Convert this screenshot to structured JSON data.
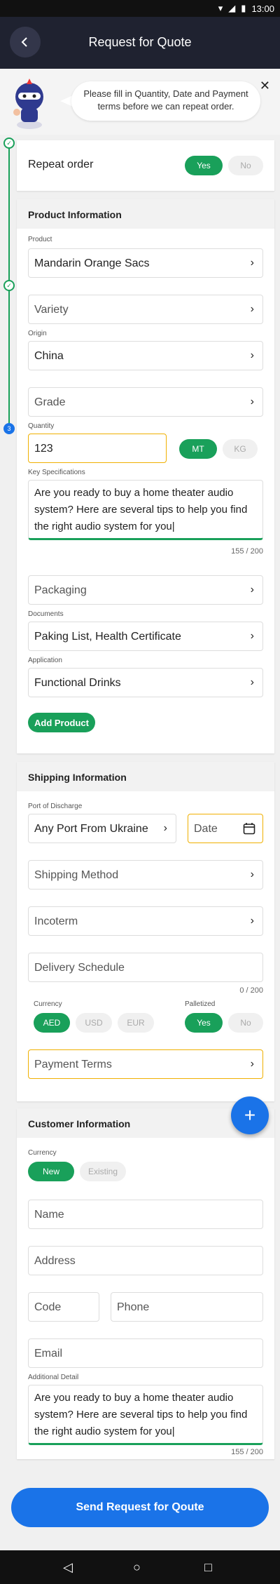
{
  "status": {
    "time": "13:00"
  },
  "header": {
    "title": "Request for Quote"
  },
  "banner": {
    "message": "Please fill in Quantity, Date and Payment terms before we can repeat order."
  },
  "steps": {
    "step3": "3"
  },
  "repeat": {
    "label": "Repeat order",
    "yes": "Yes",
    "no": "No"
  },
  "product": {
    "title": "Product Information",
    "product_label": "Product",
    "product_value": "Mandarin Orange Sacs",
    "variety_placeholder": "Variety",
    "origin_label": "Origin",
    "origin_value": "China",
    "grade_placeholder": "Grade",
    "quantity_label": "Quantity",
    "quantity_value": "123",
    "unit_mt": "MT",
    "unit_kg": "KG",
    "key_spec_label": "Key Specifications",
    "key_spec_value": "Are you ready to buy a home theater audio system? Here are several tips to help you find the right audio system for you|",
    "key_spec_counter": "155 / 200",
    "packaging_placeholder": "Packaging",
    "documents_label": "Documents",
    "documents_value": "Paking List, Health Certificate",
    "application_label": "Application",
    "application_value": "Functional Drinks",
    "add_button": "Add Product"
  },
  "shipping": {
    "title": "Shipping Information",
    "port_label": "Port of Discharge",
    "port_value": "Any Port From Ukraine",
    "date_placeholder": "Date",
    "method_placeholder": "Shipping Method",
    "incoterm_placeholder": "Incoterm",
    "schedule_placeholder": "Delivery Schedule",
    "schedule_counter": "0 / 200",
    "currency_label": "Currency",
    "cur_aed": "AED",
    "cur_usd": "USD",
    "cur_eur": "EUR",
    "palletized_label": "Palletized",
    "pal_yes": "Yes",
    "pal_no": "No",
    "payment_placeholder": "Payment Terms"
  },
  "customer": {
    "title": "Customer Information",
    "currency_label": "Currency",
    "new": "New",
    "existing": "Existing",
    "name_placeholder": "Name",
    "address_placeholder": "Address",
    "code_placeholder": "Code",
    "phone_placeholder": "Phone",
    "email_placeholder": "Email",
    "additional_label": "Additional Detail",
    "additional_value": "Are you ready to buy a home theater audio system? Here are several tips to help you find the right audio system for you|",
    "additional_counter": "155 / 200"
  },
  "fab": {
    "symbol": "+"
  },
  "send_button": "Send Request for Qoute",
  "colors": {
    "primary": "#1a73e8",
    "accent_green": "#19a05a",
    "highlight": "#f0b000",
    "header_bg": "#1f2230"
  },
  "icons": [
    "back-arrow-icon",
    "close-icon",
    "chevron-right-icon",
    "calendar-icon",
    "check-icon",
    "plus-icon"
  ]
}
